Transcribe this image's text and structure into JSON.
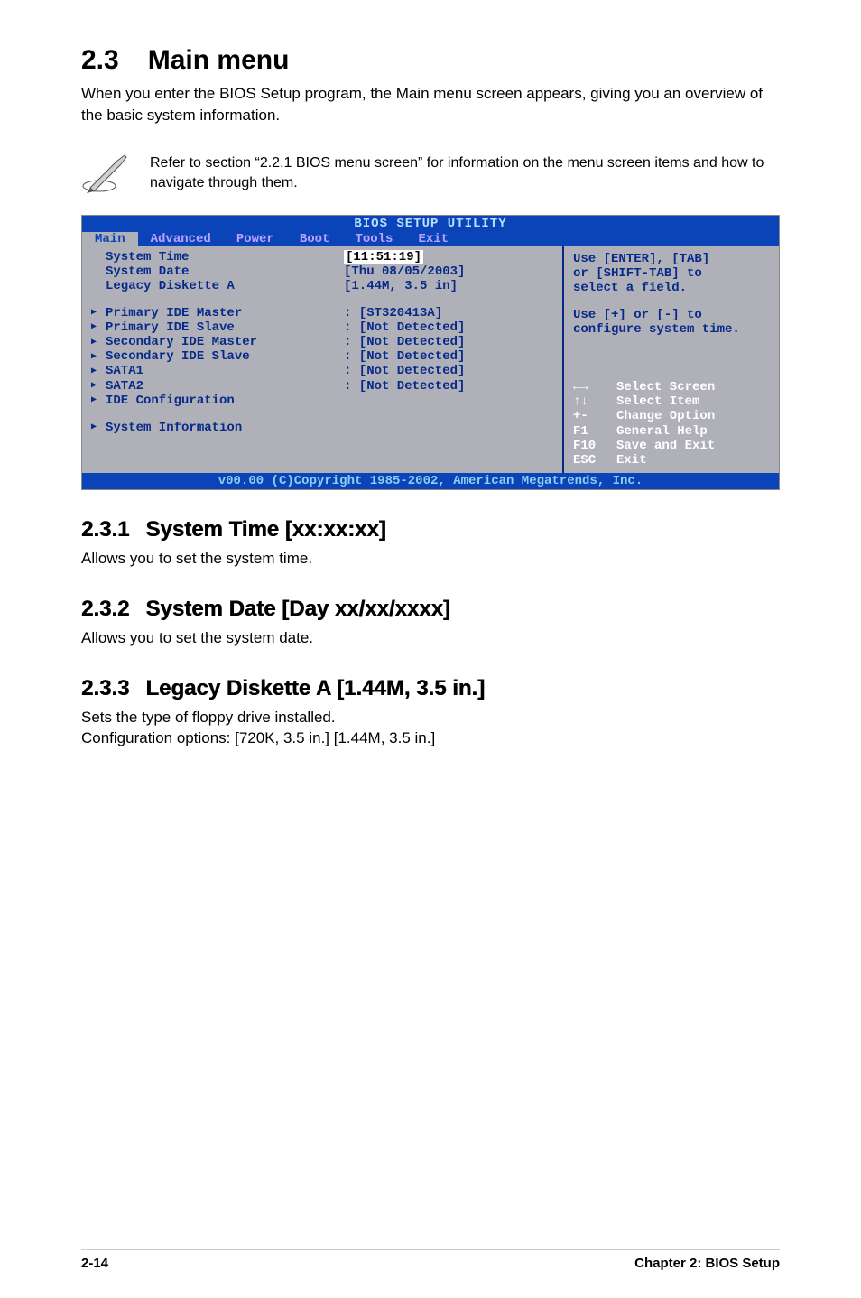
{
  "page": {
    "title_num": "2.3",
    "title_txt": "Main menu",
    "intro": "When you enter the BIOS Setup program, the Main menu screen appears, giving you an overview of the basic system information.",
    "note": "Refer to section “2.2.1  BIOS menu screen” for information on the menu screen items and how to navigate through them."
  },
  "bios": {
    "top_title": "BIOS SETUP UTILITY",
    "menus": [
      "Main",
      "Advanced",
      "Power",
      "Boot",
      "Tools",
      "Exit"
    ],
    "selected_menu_index": 0,
    "left_top": [
      {
        "label": "System Time",
        "value": "[11:51:19]",
        "selected": true
      },
      {
        "label": "System Date",
        "value": "[Thu 08/05/2003]"
      },
      {
        "label": "Legacy Diskette A",
        "value": "[1.44M, 3.5 in]"
      }
    ],
    "left_mid": [
      {
        "label": "Primary IDE Master",
        "value": ": [ST320413A]"
      },
      {
        "label": "Primary IDE Slave",
        "value": ": [Not Detected]"
      },
      {
        "label": "Secondary IDE Master",
        "value": ": [Not Detected]"
      },
      {
        "label": "Secondary IDE Slave",
        "value": ": [Not Detected]"
      },
      {
        "label": "SATA1",
        "value": ": [Not Detected]"
      },
      {
        "label": "SATA2",
        "value": ": [Not Detected]"
      },
      {
        "label": "IDE Configuration",
        "value": ""
      }
    ],
    "left_bottom": [
      {
        "label": "System Information",
        "value": ""
      }
    ],
    "right_msg1_l1": "Use [ENTER], [TAB]",
    "right_msg1_l2": "or [SHIFT-TAB] to",
    "right_msg1_l3": "select a field.",
    "right_msg2_l1": "Use [+] or [-] to",
    "right_msg2_l2": "configure system time.",
    "help": [
      {
        "key": "←→",
        "desc": "Select Screen"
      },
      {
        "key": "↑↓",
        "desc": "Select Item"
      },
      {
        "key": "+-",
        "desc": "Change Option"
      },
      {
        "key": "F1",
        "desc": "General Help"
      },
      {
        "key": "F10",
        "desc": "Save and Exit"
      },
      {
        "key": "ESC",
        "desc": "Exit"
      }
    ],
    "footer": "v00.00 (C)Copyright 1985-2002, American Megatrends, Inc."
  },
  "sections": [
    {
      "num": "2.3.1",
      "title": "System Time [xx:xx:xx]",
      "body": "Allows you to set the system time."
    },
    {
      "num": "2.3.2",
      "title": "System Date [Day xx/xx/xxxx]",
      "body": "Allows you to set the system date."
    },
    {
      "num": "2.3.3",
      "title": "Legacy Diskette A [1.44M, 3.5 in.]",
      "body": "Sets the type of floppy drive installed.\nConfiguration options: [720K, 3.5 in.] [1.44M, 3.5 in.]"
    }
  ],
  "footer": {
    "page": "2-14",
    "chapter": "Chapter 2: BIOS Setup"
  }
}
